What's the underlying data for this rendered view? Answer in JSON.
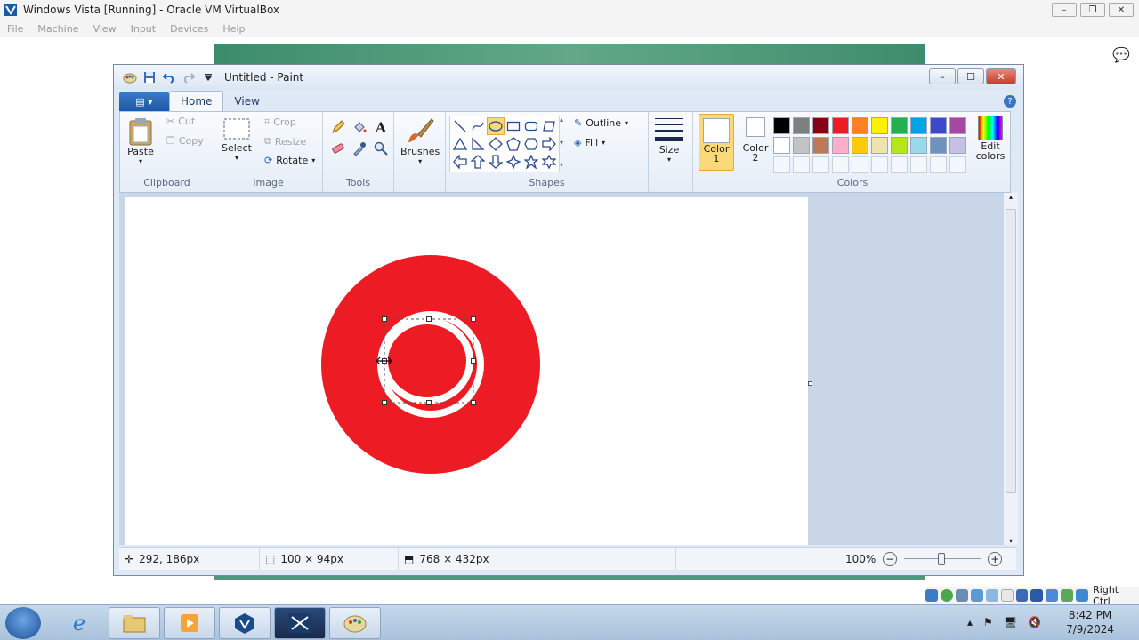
{
  "host": {
    "title": "Windows Vista [Running] - Oracle VM VirtualBox",
    "menu": [
      "File",
      "Machine",
      "View",
      "Input",
      "Devices",
      "Help"
    ],
    "right_ctrl": "Right Ctrl"
  },
  "paint": {
    "title": "Untitled - Paint",
    "tabs": {
      "home": "Home",
      "view": "View"
    },
    "clipboard": {
      "label": "Clipboard",
      "paste": "Paste",
      "cut": "Cut",
      "copy": "Copy"
    },
    "image": {
      "label": "Image",
      "select": "Select",
      "crop": "Crop",
      "resize": "Resize",
      "rotate": "Rotate"
    },
    "tools": {
      "label": "Tools"
    },
    "brushes": {
      "label": "Brushes"
    },
    "shapes": {
      "label": "Shapes",
      "outline": "Outline",
      "fill": "Fill"
    },
    "size": {
      "label": "Size"
    },
    "colors": {
      "label": "Colors",
      "color1": "Color",
      "color1_num": "1",
      "color2": "Color",
      "color2_num": "2",
      "edit": "Edit",
      "edit2": "colors",
      "row1": [
        "#000000",
        "#7f7f7f",
        "#880015",
        "#ed1c24",
        "#ff7f27",
        "#fff200",
        "#22b14c",
        "#00a2e8",
        "#3f48cc",
        "#a349a4"
      ],
      "row2": [
        "#ffffff",
        "#c3c3c3",
        "#b97a57",
        "#ffaec9",
        "#ffc90e",
        "#efe4b0",
        "#b5e61d",
        "#99d9ea",
        "#7092be",
        "#c8bfe7"
      ]
    },
    "drawing": {
      "big_circle_color": "#ed1c24"
    },
    "status": {
      "cursor": "292, 186px",
      "selection": "100 × 94px",
      "canvas_size": "768 × 432px",
      "zoom": "100%"
    }
  },
  "taskbar": {
    "time": "8:42 PM",
    "date": "7/9/2024"
  }
}
